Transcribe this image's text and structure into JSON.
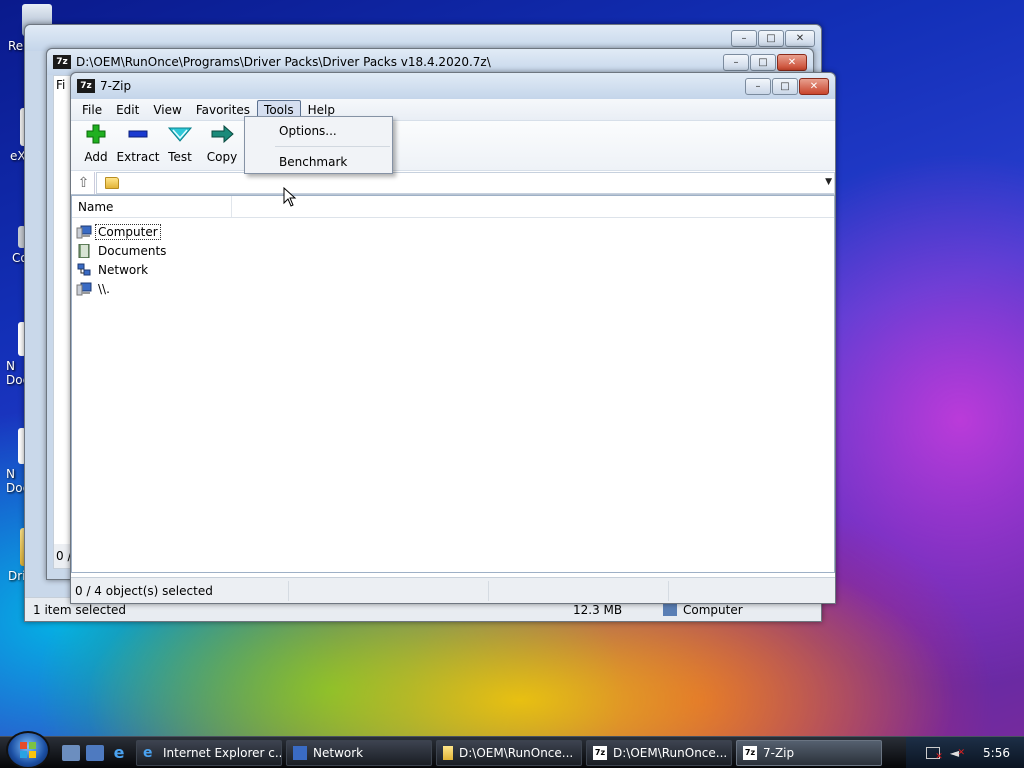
{
  "desktop": {
    "icons": [
      {
        "label": "Re"
      },
      {
        "label": "eX"
      },
      {
        "label": "Co"
      },
      {
        "label": "N Doc"
      },
      {
        "label": "N Doc"
      },
      {
        "label": "Dri"
      }
    ]
  },
  "back_window": {
    "status_left": "1 item selected",
    "status_size": "12.3 MB",
    "status_location": "Computer"
  },
  "middle_window": {
    "title": "D:\\OEM\\RunOnce\\Programs\\Driver Packs\\Driver Packs v18.4.2020.7z\\",
    "menu_stub": "Fi",
    "status_left": "0 /"
  },
  "zip_window": {
    "title": "7-Zip",
    "icon_text": "7z",
    "menu": [
      "File",
      "Edit",
      "View",
      "Favorites",
      "Tools",
      "Help"
    ],
    "toolbar": [
      {
        "label": "Add",
        "icon": "add-icon"
      },
      {
        "label": "Extract",
        "icon": "extract-icon"
      },
      {
        "label": "Test",
        "icon": "test-icon"
      },
      {
        "label": "Copy",
        "icon": "copy-icon"
      }
    ],
    "address": "",
    "column_headers": [
      "Name"
    ],
    "items": [
      {
        "label": "Computer",
        "icon": "computer-icon"
      },
      {
        "label": "Documents",
        "icon": "documents-icon"
      },
      {
        "label": "Network",
        "icon": "network-icon"
      },
      {
        "label": "\\\\.",
        "icon": "computer-icon"
      }
    ],
    "status": "0 / 4 object(s) selected",
    "tools_menu": [
      "Options...",
      "Benchmark"
    ]
  },
  "taskbar": {
    "buttons": [
      {
        "label": "Internet Explorer c..."
      },
      {
        "label": "Network"
      },
      {
        "label": "D:\\OEM\\RunOnce..."
      },
      {
        "label": "D:\\OEM\\RunOnce..."
      },
      {
        "label": "7-Zip"
      }
    ],
    "clock": "5:56"
  },
  "colors": {
    "accent": "#2b5aa7",
    "close_button": "#c9452c"
  }
}
